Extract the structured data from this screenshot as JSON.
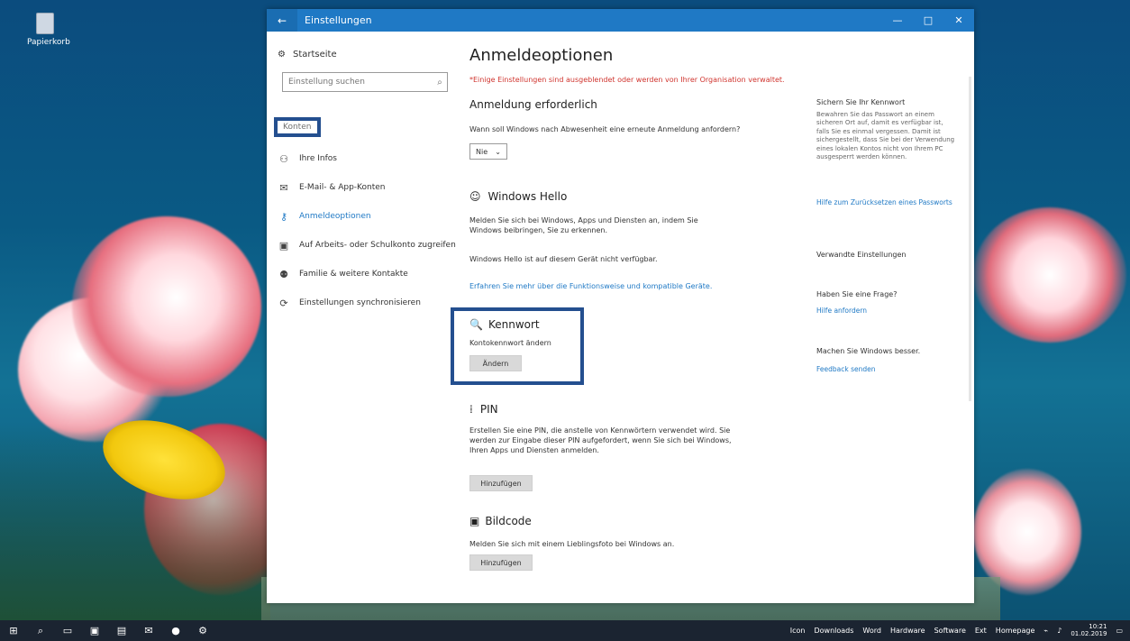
{
  "desktop": {
    "recycle_bin_label": "Papierkorb"
  },
  "window": {
    "title": "Einstellungen",
    "back_glyph": "←",
    "controls": {
      "minimize": "—",
      "maximize": "□",
      "close": "✕"
    }
  },
  "sidebar": {
    "home_label": "Startseite",
    "search_placeholder": "Einstellung suchen",
    "section_label": "Konten",
    "items": [
      {
        "label": "Ihre Infos",
        "icon": "person-card-icon",
        "active": false
      },
      {
        "label": "E-Mail- & App-Konten",
        "icon": "mail-icon",
        "active": false
      },
      {
        "label": "Anmeldeoptionen",
        "icon": "key-icon",
        "active": true
      },
      {
        "label": "Auf Arbeits- oder Schulkonto zugreifen",
        "icon": "briefcase-icon",
        "active": false
      },
      {
        "label": "Familie & weitere Kontakte",
        "icon": "people-icon",
        "active": false
      },
      {
        "label": "Einstellungen synchronisieren",
        "icon": "sync-icon",
        "active": false
      }
    ]
  },
  "content": {
    "title": "Anmeldeoptionen",
    "org_note": "*Einige Einstellungen sind ausgeblendet oder werden von Ihrer Organisation verwaltet.",
    "require_signin": {
      "heading": "Anmeldung erforderlich",
      "question": "Wann soll Windows nach Abwesenheit eine erneute Anmeldung anfordern?",
      "value": "Nie"
    },
    "windows_hello": {
      "heading": "Windows Hello",
      "description": "Melden Sie sich bei Windows, Apps und Diensten an, indem Sie Windows beibringen, Sie zu erkennen.",
      "status": "Windows Hello ist auf diesem Gerät nicht verfügbar.",
      "link": "Erfahren Sie mehr über die Funktionsweise und kompatible Geräte."
    },
    "password": {
      "heading": "Kennwort",
      "description": "Kontokennwort ändern",
      "button": "Ändern"
    },
    "pin": {
      "heading": "PIN",
      "description": "Erstellen Sie eine PIN, die anstelle von Kennwörtern verwendet wird. Sie werden zur Eingabe dieser PIN aufgefordert, wenn Sie sich bei Windows, Ihren Apps und Diensten anmelden.",
      "button": "Hinzufügen"
    },
    "picture_password": {
      "heading": "Bildcode",
      "description": "Melden Sie sich mit einem Lieblingsfoto bei Windows an.",
      "button": "Hinzufügen"
    }
  },
  "right_panel": {
    "secure_heading": "Sichern Sie Ihr Kennwort",
    "secure_text": "Bewahren Sie das Passwort an einem sicheren Ort auf, damit es verfügbar ist, falls Sie es einmal vergessen. Damit ist sichergestellt, dass Sie bei der Verwendung eines lokalen Kontos nicht von Ihrem PC ausgesperrt werden können.",
    "secure_link": "Hilfe zum Zurücksetzen eines Passworts",
    "related_heading": "Verwandte Einstellungen",
    "question_heading": "Haben Sie eine Frage?",
    "help_link": "Hilfe anfordern",
    "improve_heading": "Machen Sie Windows besser.",
    "feedback_link": "Feedback senden"
  },
  "taskbar": {
    "start_glyph": "⊞",
    "search_glyph": "⌕",
    "task_view_glyph": "▭",
    "store_glyph": "▣",
    "explorer_glyph": "▤",
    "mail_glyph": "✉",
    "chrome_glyph": "●",
    "settings_glyph": "⚙",
    "tray_items": [
      "Icon",
      "Downloads",
      "Word",
      "Hardware",
      "Software",
      "Ext",
      "Homepage"
    ],
    "clock_time": "10:21",
    "clock_date": "01.02.2019"
  }
}
